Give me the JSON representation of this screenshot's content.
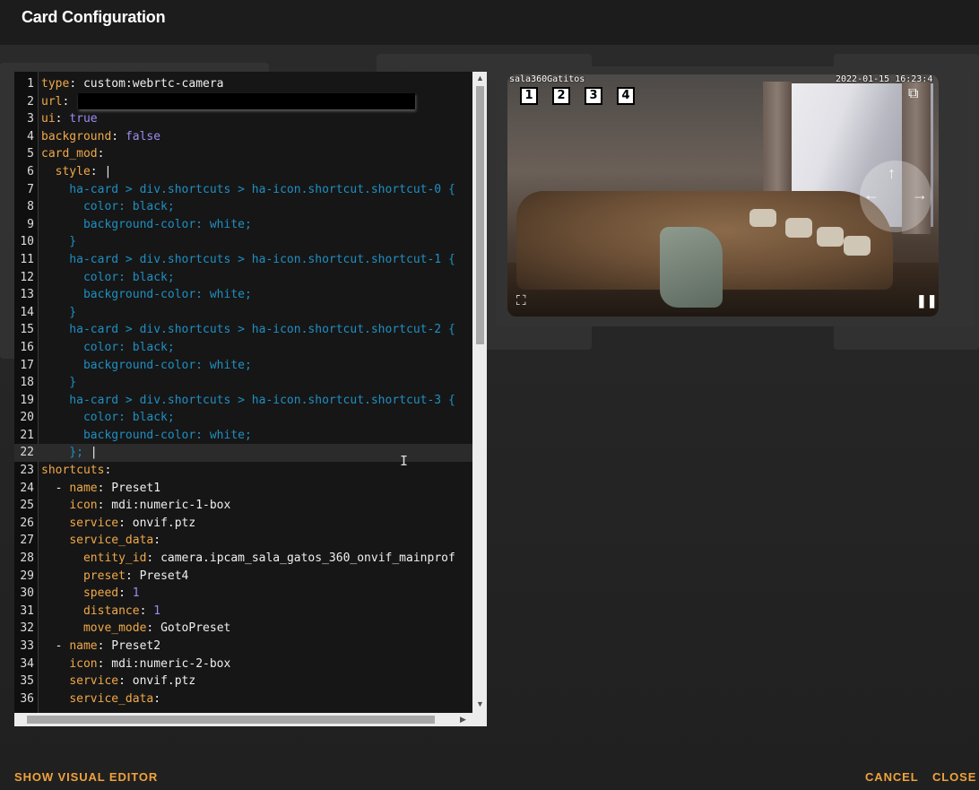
{
  "dialog": {
    "title": "Card Configuration"
  },
  "editor": {
    "lines": [
      {
        "n": "1",
        "parts": [
          [
            "k",
            "type"
          ],
          [
            "s",
            ": custom:webrtc-camera"
          ]
        ]
      },
      {
        "n": "2",
        "parts": [
          [
            "k",
            "url"
          ],
          [
            "s",
            ": "
          ]
        ],
        "redacted": true
      },
      {
        "n": "3",
        "parts": [
          [
            "k",
            "ui"
          ],
          [
            "s",
            ": "
          ],
          [
            "n",
            "true"
          ]
        ]
      },
      {
        "n": "4",
        "parts": [
          [
            "k",
            "background"
          ],
          [
            "s",
            ": "
          ],
          [
            "n",
            "false"
          ]
        ]
      },
      {
        "n": "5",
        "parts": [
          [
            "k",
            "card_mod"
          ],
          [
            "s",
            ":"
          ]
        ]
      },
      {
        "n": "6",
        "parts": [
          [
            "s",
            "  "
          ],
          [
            "k",
            "style"
          ],
          [
            "s",
            ": |"
          ]
        ]
      },
      {
        "n": "7",
        "parts": [
          [
            "css",
            "    ha-card > div.shortcuts > ha-icon.shortcut.shortcut-0 {"
          ]
        ]
      },
      {
        "n": "8",
        "parts": [
          [
            "css",
            "      color: black;"
          ]
        ]
      },
      {
        "n": "9",
        "parts": [
          [
            "css",
            "      background-color: white;"
          ]
        ]
      },
      {
        "n": "10",
        "parts": [
          [
            "css",
            "    }"
          ]
        ]
      },
      {
        "n": "11",
        "parts": [
          [
            "css",
            "    ha-card > div.shortcuts > ha-icon.shortcut.shortcut-1 {"
          ]
        ]
      },
      {
        "n": "12",
        "parts": [
          [
            "css",
            "      color: black;"
          ]
        ]
      },
      {
        "n": "13",
        "parts": [
          [
            "css",
            "      background-color: white;"
          ]
        ]
      },
      {
        "n": "14",
        "parts": [
          [
            "css",
            "    }"
          ]
        ]
      },
      {
        "n": "15",
        "parts": [
          [
            "css",
            "    ha-card > div.shortcuts > ha-icon.shortcut.shortcut-2 {"
          ]
        ]
      },
      {
        "n": "16",
        "parts": [
          [
            "css",
            "      color: black;"
          ]
        ]
      },
      {
        "n": "17",
        "parts": [
          [
            "css",
            "      background-color: white;"
          ]
        ]
      },
      {
        "n": "18",
        "parts": [
          [
            "css",
            "    }"
          ]
        ]
      },
      {
        "n": "19",
        "parts": [
          [
            "css",
            "    ha-card > div.shortcuts > ha-icon.shortcut.shortcut-3 {"
          ]
        ]
      },
      {
        "n": "20",
        "parts": [
          [
            "css",
            "      color: black;"
          ]
        ]
      },
      {
        "n": "21",
        "parts": [
          [
            "css",
            "      background-color: white;"
          ]
        ]
      },
      {
        "n": "22",
        "parts": [
          [
            "css",
            "    }; "
          ],
          [
            "s",
            "|"
          ]
        ],
        "active": true
      },
      {
        "n": "23",
        "parts": [
          [
            "k",
            "shortcuts"
          ],
          [
            "s",
            ":"
          ]
        ]
      },
      {
        "n": "24",
        "parts": [
          [
            "s",
            "  - "
          ],
          [
            "k",
            "name"
          ],
          [
            "s",
            ": Preset1"
          ]
        ]
      },
      {
        "n": "25",
        "parts": [
          [
            "s",
            "    "
          ],
          [
            "k",
            "icon"
          ],
          [
            "s",
            ": mdi:numeric-1-box"
          ]
        ]
      },
      {
        "n": "26",
        "parts": [
          [
            "s",
            "    "
          ],
          [
            "k",
            "service"
          ],
          [
            "s",
            ": onvif.ptz"
          ]
        ]
      },
      {
        "n": "27",
        "parts": [
          [
            "s",
            "    "
          ],
          [
            "k",
            "service_data"
          ],
          [
            "s",
            ":"
          ]
        ]
      },
      {
        "n": "28",
        "parts": [
          [
            "s",
            "      "
          ],
          [
            "k",
            "entity_id"
          ],
          [
            "s",
            ": camera.ipcam_sala_gatos_360_onvif_mainprof"
          ]
        ]
      },
      {
        "n": "29",
        "parts": [
          [
            "s",
            "      "
          ],
          [
            "k",
            "preset"
          ],
          [
            "s",
            ": Preset4"
          ]
        ]
      },
      {
        "n": "30",
        "parts": [
          [
            "s",
            "      "
          ],
          [
            "k",
            "speed"
          ],
          [
            "s",
            ": "
          ],
          [
            "n",
            "1"
          ]
        ]
      },
      {
        "n": "31",
        "parts": [
          [
            "s",
            "      "
          ],
          [
            "k",
            "distance"
          ],
          [
            "s",
            ": "
          ],
          [
            "n",
            "1"
          ]
        ]
      },
      {
        "n": "32",
        "parts": [
          [
            "s",
            "      "
          ],
          [
            "k",
            "move_mode"
          ],
          [
            "s",
            ": GotoPreset"
          ]
        ]
      },
      {
        "n": "33",
        "parts": [
          [
            "s",
            "  - "
          ],
          [
            "k",
            "name"
          ],
          [
            "s",
            ": Preset2"
          ]
        ]
      },
      {
        "n": "34",
        "parts": [
          [
            "s",
            "    "
          ],
          [
            "k",
            "icon"
          ],
          [
            "s",
            ": mdi:numeric-2-box"
          ]
        ]
      },
      {
        "n": "35",
        "parts": [
          [
            "s",
            "    "
          ],
          [
            "k",
            "service"
          ],
          [
            "s",
            ": onvif.ptz"
          ]
        ]
      },
      {
        "n": "36",
        "parts": [
          [
            "s",
            "    "
          ],
          [
            "k",
            "service_data"
          ],
          [
            "s",
            ":"
          ]
        ]
      }
    ]
  },
  "preview": {
    "camera_name": "sala360Gatitos",
    "timestamp": "2022-01-15 16:23:4",
    "shortcuts": [
      "1",
      "2",
      "3",
      "4"
    ],
    "icons": {
      "fullscreen": "fullscreen-icon",
      "pause": "pause-icon",
      "ptz": "ptz-control",
      "pip": "picture-in-picture-icon"
    }
  },
  "footer": {
    "show_visual_editor": "SHOW VISUAL EDITOR",
    "cancel": "CANCEL",
    "close": "CLOSE"
  },
  "colors": {
    "accent": "#f0a23b",
    "yaml_key": "#f0a94a",
    "yaml_literal": "#9b8cf3",
    "css_block": "#1f8fc2"
  }
}
